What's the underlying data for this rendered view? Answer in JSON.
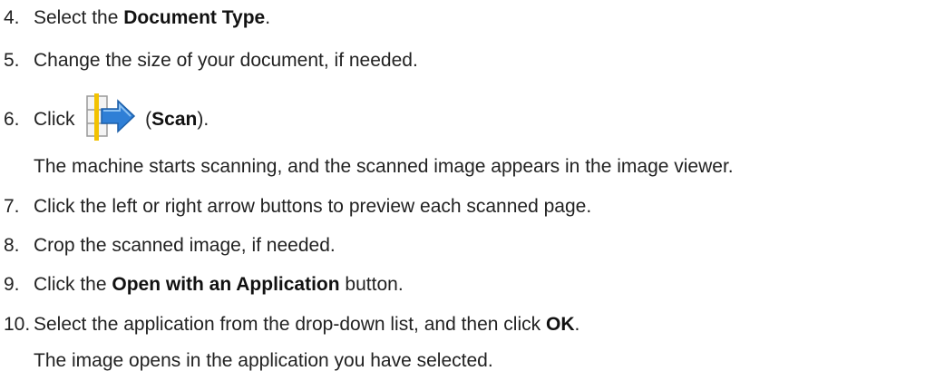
{
  "steps": [
    {
      "number": "4.",
      "parts": [
        {
          "text": "Select the ",
          "bold": false
        },
        {
          "text": "Document Type",
          "bold": true
        },
        {
          "text": ".",
          "bold": false
        }
      ]
    },
    {
      "number": "5.",
      "parts": [
        {
          "text": "Change the size of your document, if needed.",
          "bold": false
        }
      ]
    },
    {
      "number": "6.",
      "before_icon": "Click ",
      "icon": "scan-icon",
      "after_icon_prefix": " (",
      "bold": "Scan",
      "after_icon_suffix": ")."
    },
    {
      "note": "The machine starts scanning, and the scanned image appears in the image viewer."
    },
    {
      "number": "7.",
      "parts": [
        {
          "text": "Click the left or right arrow buttons to preview each scanned page.",
          "bold": false
        }
      ]
    },
    {
      "number": "8.",
      "parts": [
        {
          "text": "Crop the scanned image, if needed.",
          "bold": false
        }
      ]
    },
    {
      "number": "9.",
      "parts": [
        {
          "text": "Click the ",
          "bold": false
        },
        {
          "text": "Open with an Application",
          "bold": true
        },
        {
          "text": " button.",
          "bold": false
        }
      ]
    },
    {
      "number": "10.",
      "parts": [
        {
          "text": "Select the application from the drop-down list, and then click ",
          "bold": false
        },
        {
          "text": "OK",
          "bold": true
        },
        {
          "text": ".",
          "bold": false
        }
      ]
    },
    {
      "note": "The image opens in the application you have selected."
    }
  ],
  "colors": {
    "text": "#222222",
    "icon_arrow": "#2f7fd6",
    "icon_bar": "#f2c200"
  }
}
